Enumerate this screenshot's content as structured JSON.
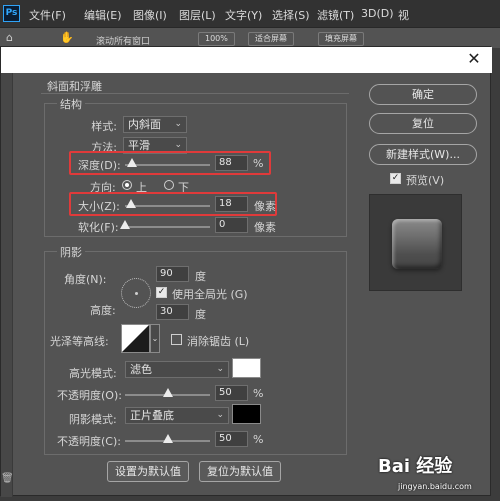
{
  "menubar": {
    "items": [
      "文件(F)",
      "编辑(E)",
      "图像(I)",
      "图层(L)",
      "文字(Y)",
      "选择(S)",
      "滤镜(T)",
      "3D(D)",
      "视"
    ]
  },
  "optionsbar": {
    "scroll_all": "滚动所有窗口",
    "zoom": "100%",
    "fit_screen": "适合屏幕",
    "fill_screen": "填充屏幕"
  },
  "dialog": {
    "bevel": {
      "title": "斜面和浮雕",
      "structure_title": "结构",
      "style_label": "样式:",
      "style_value": "内斜面",
      "technique_label": "方法:",
      "technique_value": "平滑",
      "depth_label": "深度(D):",
      "depth_value": "88",
      "depth_unit": "%",
      "depth_level": 0.088,
      "direction_label": "方向:",
      "direction_up": "上",
      "direction_down": "下",
      "size_label": "大小(Z):",
      "size_value": "18",
      "size_unit": "像素",
      "size_level": 0.072,
      "soften_label": "软化(F):",
      "soften_value": "0",
      "soften_unit": "像素",
      "soften_level": 0.0
    },
    "shading": {
      "title": "阴影",
      "angle_label": "角度(N):",
      "angle_value": "90",
      "angle_unit": "度",
      "global_light": "使用全局光 (G)",
      "altitude_label": "高度:",
      "altitude_value": "30",
      "altitude_unit": "度",
      "gloss_label": "光泽等高线:",
      "anti_alias": "消除锯齿 (L)",
      "highlight_label": "高光模式:",
      "highlight_mode": "滤色",
      "highlight_color": "#ffffff",
      "highlight_opacity_label": "不透明度(O):",
      "highlight_opacity": "50",
      "highlight_opacity_level": 0.5,
      "shadow_label": "阴影模式:",
      "shadow_mode": "正片叠底",
      "shadow_color": "#000000",
      "shadow_opacity_label": "不透明度(C):",
      "shadow_opacity": "50",
      "shadow_opacity_level": 0.5,
      "percent": "%"
    },
    "buttons": {
      "ok": "确定",
      "reset": "复位",
      "new_style": "新建样式(W)...",
      "preview": "预览(V)",
      "set_default": "设置为默认值",
      "reset_default": "复位为默认值"
    }
  },
  "watermark": {
    "brand": "Bai 经验",
    "url": "jingyan.baidu.com"
  },
  "colors": {
    "highlight_box": "#e03a3a",
    "panel": "#535353"
  }
}
